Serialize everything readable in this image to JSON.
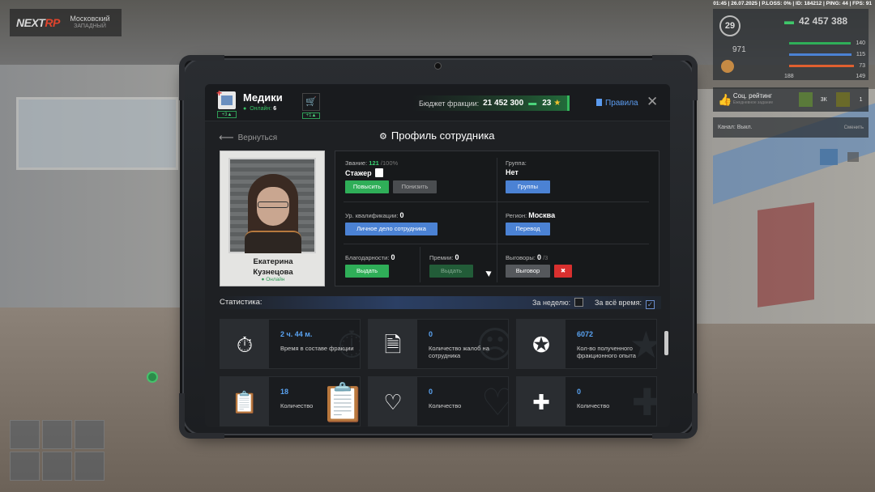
{
  "server": {
    "logo": "NEXTRP",
    "logo_main": "NEXT",
    "logo_accent": "RP",
    "name": "Московский",
    "subname": "ЗАПАДНЫЙ"
  },
  "top_info": "01:45 | 26.07.2025 | P.LOSS: 0% | ID: 184212 | PING: 44 | FPS: 91",
  "hud": {
    "level": "29",
    "money": "42 457 388",
    "score": "971",
    "stats": [
      {
        "value": "140",
        "color": "#2fae58"
      },
      {
        "value": "115",
        "color": "#4b82d4"
      },
      {
        "value": "73",
        "color": "#e06030"
      },
      {
        "value": "149",
        "color": "#cccccc"
      }
    ],
    "bottom_small": "188",
    "social_title": "Соц. рейтинг",
    "social_sub": "Ежедневное задание",
    "social_val1": "3К",
    "social_val2": "1",
    "channel": "Канал: Выкл.",
    "channel_switch": "Сменить"
  },
  "faction": {
    "name": "Медики",
    "online_label": "Онлайн:",
    "online_count": "6",
    "badge": "+3",
    "cart_badge": "+1",
    "budget_label": "Бюджет фракции:",
    "budget_value": "21 452 300",
    "stars": "23",
    "rules": "Правила"
  },
  "nav": {
    "back": "Вернуться",
    "title": "Профиль сотрудника"
  },
  "employee": {
    "first_name": "Екатерина",
    "last_name": "Кузнецова",
    "status": "Онлайн"
  },
  "info": {
    "rank_label": "Звание:",
    "rank_progress": "121",
    "rank_max": "/100%",
    "rank_value": "Стажер",
    "promote": "Повысить",
    "demote": "Понизить",
    "group_label": "Группа:",
    "group_value": "Нет",
    "groups_btn": "Группы",
    "qual_label": "Ур. квалификации:",
    "qual_value": "0",
    "personal_file": "Личное дело сотрудника",
    "region_label": "Регион:",
    "region_value": "Москва",
    "transfer": "Перевод",
    "thanks_label": "Благодарности:",
    "thanks_value": "0",
    "give": "Выдать",
    "bonus_label": "Премии:",
    "bonus_value": "0",
    "give_bonus": "Выдать",
    "reprimand_label": "Выговоры:",
    "reprimand_value": "0",
    "reprimand_max": "/3",
    "reprimand_btn": "Выговор"
  },
  "stats": {
    "title": "Статистика:",
    "week": "За неделю:",
    "all_time": "За всё время:",
    "cards": [
      {
        "value": "2 ч. 44 м.",
        "label": "Время в составе фракции",
        "icon": "stopwatch-icon"
      },
      {
        "value": "0",
        "label": "Количество жалоб на сотрудника",
        "icon": "complaint-doc-icon"
      },
      {
        "value": "6072",
        "label": "Кол-во полученного фракционного опыта",
        "icon": "exp-badge-icon"
      },
      {
        "value": "18",
        "label": "Количество",
        "icon": "clipboard-icon"
      },
      {
        "value": "0",
        "label": "Количество",
        "icon": "heartbeat-icon"
      },
      {
        "value": "0",
        "label": "Количество",
        "icon": "medkit-icon"
      }
    ]
  }
}
